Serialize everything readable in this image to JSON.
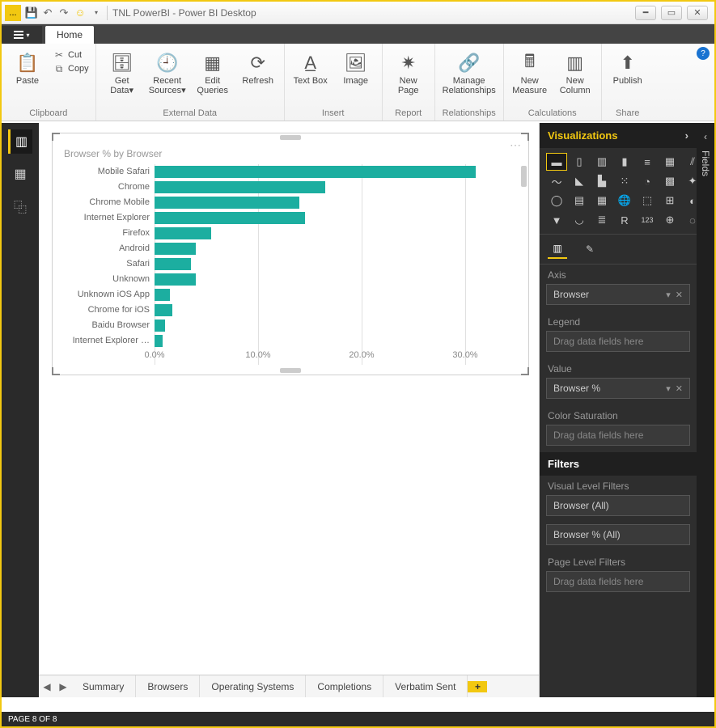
{
  "title_separator": " | ",
  "title_doc": "TNL PowerBI",
  "title_app": " - Power BI Desktop",
  "tabs": {
    "home": "Home"
  },
  "ribbon": {
    "clipboard": {
      "label": "Clipboard",
      "paste": "Paste",
      "cut": "Cut",
      "copy": "Copy"
    },
    "external": {
      "label": "External Data",
      "getdata": "Get Data▾",
      "recent": "Recent Sources▾",
      "edit": "Edit Queries",
      "refresh": "Refresh"
    },
    "insert": {
      "label": "Insert",
      "textbox": "Text Box",
      "image": "Image"
    },
    "report": {
      "label": "Report",
      "newpage": "New Page"
    },
    "relationships": {
      "label": "Relationships",
      "manage": "Manage Relationships"
    },
    "calc": {
      "label": "Calculations",
      "newmeasure": "New Measure",
      "newcolumn": "New Column"
    },
    "share": {
      "label": "Share",
      "publish": "Publish"
    }
  },
  "chart_title": "Browser % by Browser",
  "chart_data": {
    "type": "bar",
    "orientation": "horizontal",
    "title": "Browser % by Browser",
    "xlabel": "",
    "ylabel": "",
    "xlim": [
      0,
      35
    ],
    "x_ticks": [
      0,
      10,
      20,
      30
    ],
    "x_tick_labels": [
      "0.0%",
      "10.0%",
      "20.0%",
      "30.0%"
    ],
    "categories": [
      "Mobile Safari",
      "Chrome",
      "Chrome Mobile",
      "Internet Explorer",
      "Firefox",
      "Android",
      "Safari",
      "Unknown",
      "Unknown iOS App",
      "Chrome for iOS",
      "Baidu Browser",
      "Internet Explorer …"
    ],
    "values": [
      31.0,
      16.5,
      14.0,
      14.5,
      5.5,
      4.0,
      3.5,
      4.0,
      1.5,
      1.7,
      1.0,
      0.8
    ],
    "bar_color": "#1caea0"
  },
  "page_tabs": [
    "Summary",
    "Browsers",
    "Operating Systems",
    "Completions",
    "Verbatim Sent"
  ],
  "vis_panel": {
    "header": "Visualizations",
    "axis_label": "Axis",
    "axis_value": "Browser",
    "legend_label": "Legend",
    "value_label": "Value",
    "value_value": "Browser %",
    "color_sat": "Color Saturation",
    "drag_hint": "Drag data fields here",
    "filters": "Filters",
    "visual_filters": "Visual Level Filters",
    "filter1": "Browser (All)",
    "filter2": "Browser % (All)",
    "page_filters": "Page Level Filters"
  },
  "fields_label": "Fields",
  "status": "PAGE 8 OF 8"
}
